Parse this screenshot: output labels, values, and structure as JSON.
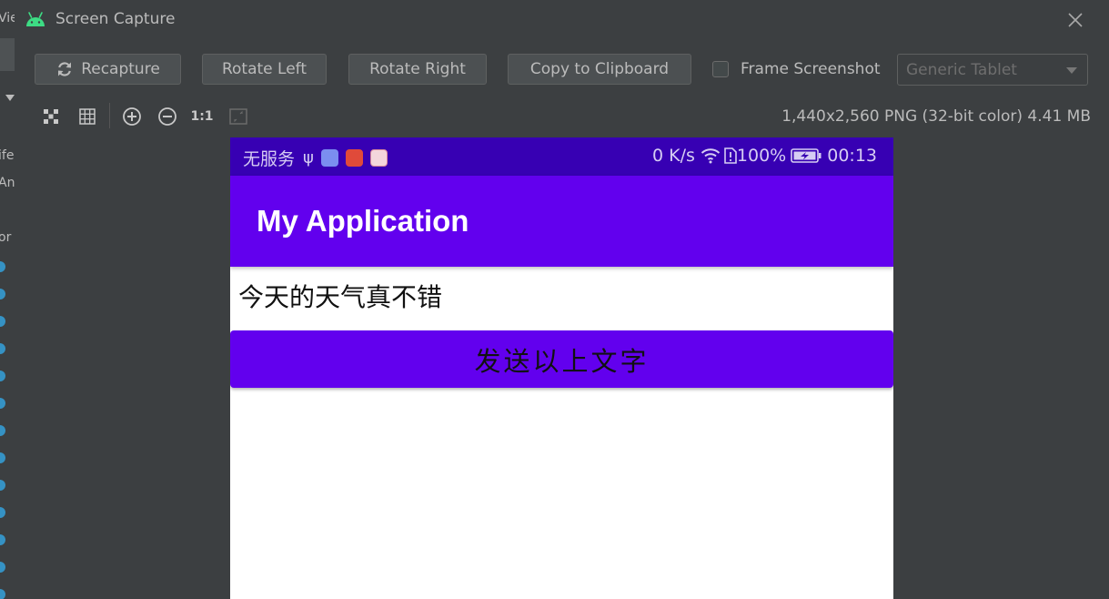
{
  "ide": {
    "fragments": [
      "Vie",
      "ife",
      "And",
      "or"
    ]
  },
  "dialog": {
    "title": "Screen Capture",
    "toolbar": {
      "recapture_label": "Recapture",
      "rotate_left_label": "Rotate Left",
      "rotate_right_label": "Rotate Right",
      "copy_label": "Copy to Clipboard",
      "frame_screenshot_label": "Frame Screenshot",
      "frame_screenshot_checked": false,
      "device_frame_value": "Generic Tablet"
    },
    "zoom_tools": {
      "actual_size_label": "1:1"
    },
    "image_info": "1,440x2,560 PNG (32-bit color) 4.41 MB"
  },
  "phone": {
    "statusbar": {
      "carrier": "无服务",
      "usb_symbol": "ψ",
      "net_speed": "0 K/s",
      "battery": "100%",
      "time": "00:13"
    },
    "app_title": "My Application",
    "text_content": "今天的天气真不错",
    "send_button_label": "发送以上文字"
  },
  "colors": {
    "status_bar": "#3700b3",
    "primary": "#6200ee",
    "dialog_bg": "#3c3f41"
  }
}
